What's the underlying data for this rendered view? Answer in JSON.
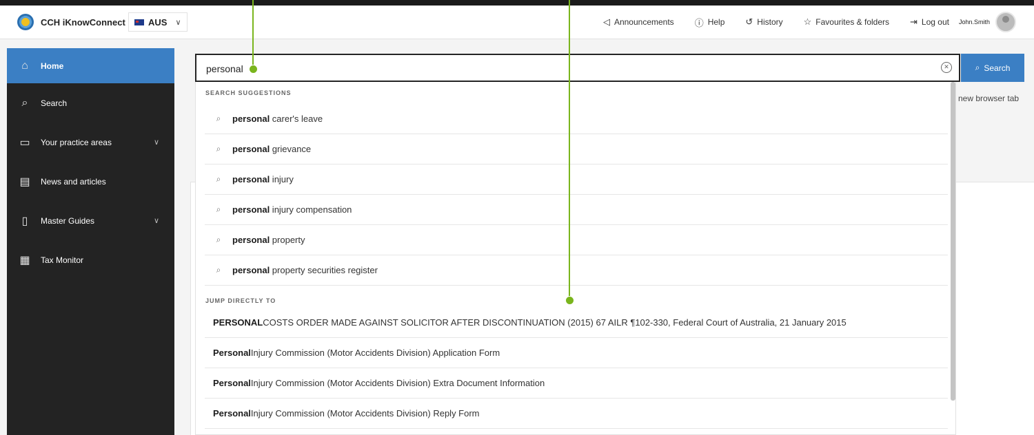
{
  "topbar": {
    "brand": "CCH iKnowConnect",
    "country": "AUS",
    "nav": [
      {
        "icon": "megaphone-icon",
        "glyph": "◁",
        "label": "Announcements"
      },
      {
        "icon": "help-icon",
        "glyph": "ⓘ",
        "label": "Help"
      },
      {
        "icon": "history-icon",
        "glyph": "↺",
        "label": "History"
      },
      {
        "icon": "star-icon",
        "glyph": "☆",
        "label": "Favourites & folders"
      },
      {
        "icon": "logout-icon",
        "glyph": "⇥",
        "label": "Log out"
      }
    ],
    "username": "John.Smith"
  },
  "sidebar": {
    "items": [
      {
        "label": "Home",
        "icon": "home-icon",
        "glyph": "⌂",
        "active": true,
        "expandable": false
      },
      {
        "label": "Search",
        "icon": "search-icon",
        "glyph": "⌕",
        "active": false,
        "expandable": false
      },
      {
        "label": "Your practice areas",
        "icon": "briefcase-icon",
        "glyph": "▭",
        "active": false,
        "expandable": true
      },
      {
        "label": "News and articles",
        "icon": "newspaper-icon",
        "glyph": "▤",
        "active": false,
        "expandable": false
      },
      {
        "label": "Master Guides",
        "icon": "book-icon",
        "glyph": "▯",
        "active": false,
        "expandable": true
      },
      {
        "label": "Tax Monitor",
        "icon": "tax-monitor-icon",
        "glyph": "▦",
        "active": false,
        "expandable": false
      }
    ]
  },
  "search": {
    "value": "personal",
    "button_label": "Search",
    "side_note": "new browser tab"
  },
  "dropdown": {
    "suggestions_heading": "SEARCH SUGGESTIONS",
    "suggestions": [
      {
        "bold": "personal",
        "rest": " carer's leave"
      },
      {
        "bold": "personal",
        "rest": " grievance"
      },
      {
        "bold": "personal",
        "rest": " injury"
      },
      {
        "bold": "personal",
        "rest": " injury compensation"
      },
      {
        "bold": "personal",
        "rest": " property"
      },
      {
        "bold": "personal",
        "rest": " property securities register"
      }
    ],
    "jump_heading": "JUMP DIRECTLY TO",
    "jump_items": [
      {
        "bold": "PERSONAL",
        "rest": " COSTS ORDER MADE AGAINST SOLICITOR AFTER DISCONTINUATION (2015) 67 AILR ¶102-330, Federal Court of Australia, 21 January 2015"
      },
      {
        "bold": "Personal",
        "rest": " Injury Commission (Motor Accidents Division) Application Form"
      },
      {
        "bold": "Personal",
        "rest": " Injury Commission (Motor Accidents Division) Extra Document Information"
      },
      {
        "bold": "Personal",
        "rest": " Injury Commission (Motor Accidents Division) Reply Form"
      }
    ]
  },
  "colors": {
    "accent": "#3b7fc4",
    "callout": "#7ab51d",
    "sidebar_bg": "#232323"
  }
}
